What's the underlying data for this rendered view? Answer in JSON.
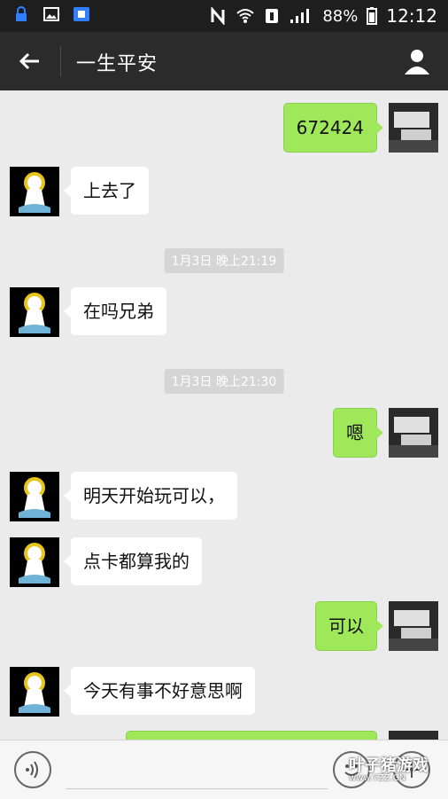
{
  "statusbar": {
    "icons": [
      "lock-icon",
      "image-icon",
      "paste-app-icon",
      "nfc-icon",
      "wifi-icon",
      "sim-icon",
      "4g-icon",
      "signal-icon",
      "battery-icon"
    ],
    "battery": "88%",
    "time": "12:12"
  },
  "topbar": {
    "title": "一生平安"
  },
  "chat": {
    "messages": [
      {
        "side": "right",
        "text": "672424"
      },
      {
        "side": "left",
        "text": "上去了"
      },
      {
        "type": "time",
        "text": "1月3日 晚上21:19"
      },
      {
        "side": "left",
        "text": "在吗兄弟"
      },
      {
        "type": "time",
        "text": "1月3日 晚上21:30"
      },
      {
        "side": "right",
        "text": "嗯"
      },
      {
        "side": "left",
        "text": "明天开始玩可以，"
      },
      {
        "side": "left",
        "text": "点卡都算我的"
      },
      {
        "side": "right",
        "text": "可以"
      },
      {
        "side": "left",
        "text": "今天有事不好意思啊"
      }
    ]
  },
  "inputbar": {
    "placeholder": "",
    "value": ""
  },
  "watermark": {
    "text": "叶子猪游戏",
    "url": "www.YZZ.CN"
  },
  "colors": {
    "bubble_right": "#9fe85a",
    "bubble_left": "#ffffff",
    "topbar": "#2b2b2b",
    "statusbar": "#1e1e1e"
  }
}
